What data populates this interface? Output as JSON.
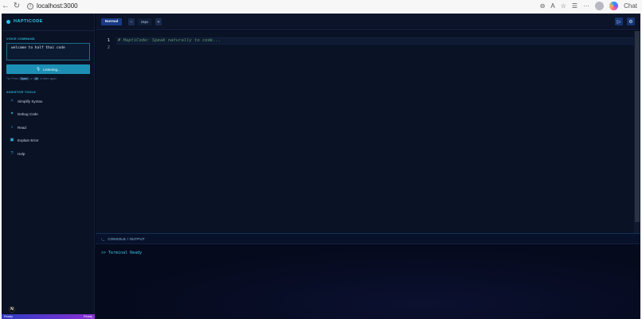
{
  "browser": {
    "url": "localhost:3000",
    "chat_label": "Chat"
  },
  "sidebar": {
    "brand": "HAPTICODE",
    "voice_section_label": "VOICE COMMAND",
    "voice_text": "welcome to half thai code",
    "listen_button": "Listening...",
    "tip_prefix": "Tip: Press",
    "tip_key1": "Space",
    "tip_or": "or",
    "tip_key2": "Alt",
    "tip_suffix": "to listen again",
    "tools_section_label": "ASSISTIVE TOOLS",
    "tools": [
      {
        "label": "Simplify Syntax",
        "icon": "sparkle-icon"
      },
      {
        "label": "Debug Code",
        "icon": "bug-icon"
      },
      {
        "label": "Read",
        "icon": "speaker-icon"
      },
      {
        "label": "Explain Error",
        "icon": "robot-icon"
      },
      {
        "label": "Help",
        "icon": "help-icon"
      }
    ],
    "status_left": "Ready",
    "status_right": "Ready"
  },
  "toolbar": {
    "mode_label": "Normal",
    "decrease_label": "−",
    "font_size": "16px",
    "increase_label": "+"
  },
  "editor": {
    "line_numbers": [
      "1",
      "2"
    ],
    "code_line_1": "# HaptiCode: Speak naturally to code..."
  },
  "console": {
    "title": "CONSOLE / OUTPUT",
    "output": ">> Terminal Ready"
  },
  "colors": {
    "accent": "#2fc8ea",
    "background": "#050a1c",
    "listen_button": "#1c8fb4",
    "mode_button": "#183a86"
  }
}
